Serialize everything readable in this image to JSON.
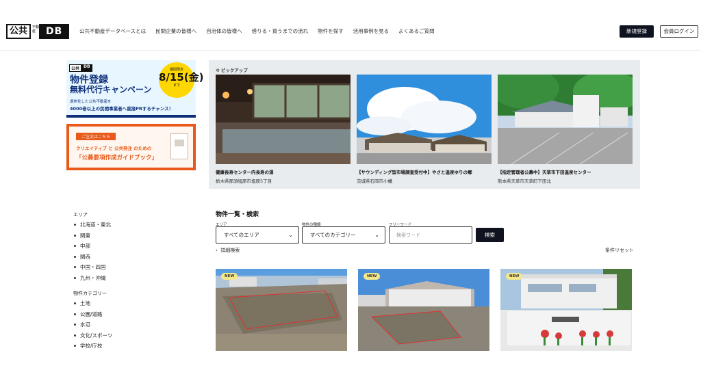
{
  "header": {
    "logo_kanji": "公共",
    "logo_small": "不動産",
    "logo_db": "DB",
    "nav": [
      "公共不動産データベースとは",
      "民間企業の皆様へ",
      "自治体の皆様へ",
      "借りる・買うまでの流れ",
      "物件を探す",
      "活用事例を見る",
      "よくあるご質問"
    ],
    "register": "新規登録",
    "login": "会員ログイン"
  },
  "banner1": {
    "logo_kanji": "公共",
    "logo_db": "DB",
    "title1": "物件登録",
    "title2": "無料代行キャンペーン",
    "sub1": "遊休化した公共不動産を",
    "sub2": "4000者以上の民間事業者へ直接PRするチャンス！",
    "circle_top": "期間限定",
    "circle_date": "8/15(金)",
    "circle_bottom": "まで"
  },
  "banner2": {
    "tag": "ご注文はこちら",
    "line1": "クリエイティブ と 公共発注 のための",
    "line2": "「公募要項作成ガイドブック」"
  },
  "pickup": {
    "label": "ピックアップ",
    "items": [
      {
        "title": "健康長寿センター内長寿の湯",
        "address": "栃木県那須塩原市塩原5丁目"
      },
      {
        "title": "【サウンディング型市場調査受付中】やさと温泉ゆりの郷",
        "address": "茨城県石岡市小幡"
      },
      {
        "title": "【指定管理者公募中】天草市下田温泉センター",
        "address": "熊本県天草市天草町下田北"
      }
    ]
  },
  "sidebar": {
    "area_heading": "エリア",
    "areas": [
      "北海道・東北",
      "関東",
      "中部",
      "関西",
      "中国・四国",
      "九州・沖縄"
    ],
    "category_heading": "物件カテゴリー",
    "categories": [
      "土地",
      "公園/道路",
      "水辺",
      "文化/スポーツ",
      "学校/庁校"
    ]
  },
  "search": {
    "title": "物件一覧・検索",
    "area_label": "エリア",
    "area_value": "すべてのエリア",
    "type_label": "物件の種類",
    "type_value": "すべてのカテゴリー",
    "free_label": "フリーワード",
    "placeholder": "検索ワード",
    "button": "検索",
    "detail": "詳細検索",
    "reset": "条件リセット"
  },
  "listings": [
    {
      "badge": "NEW"
    },
    {
      "badge": "NEW"
    },
    {
      "badge": "NEW"
    }
  ]
}
